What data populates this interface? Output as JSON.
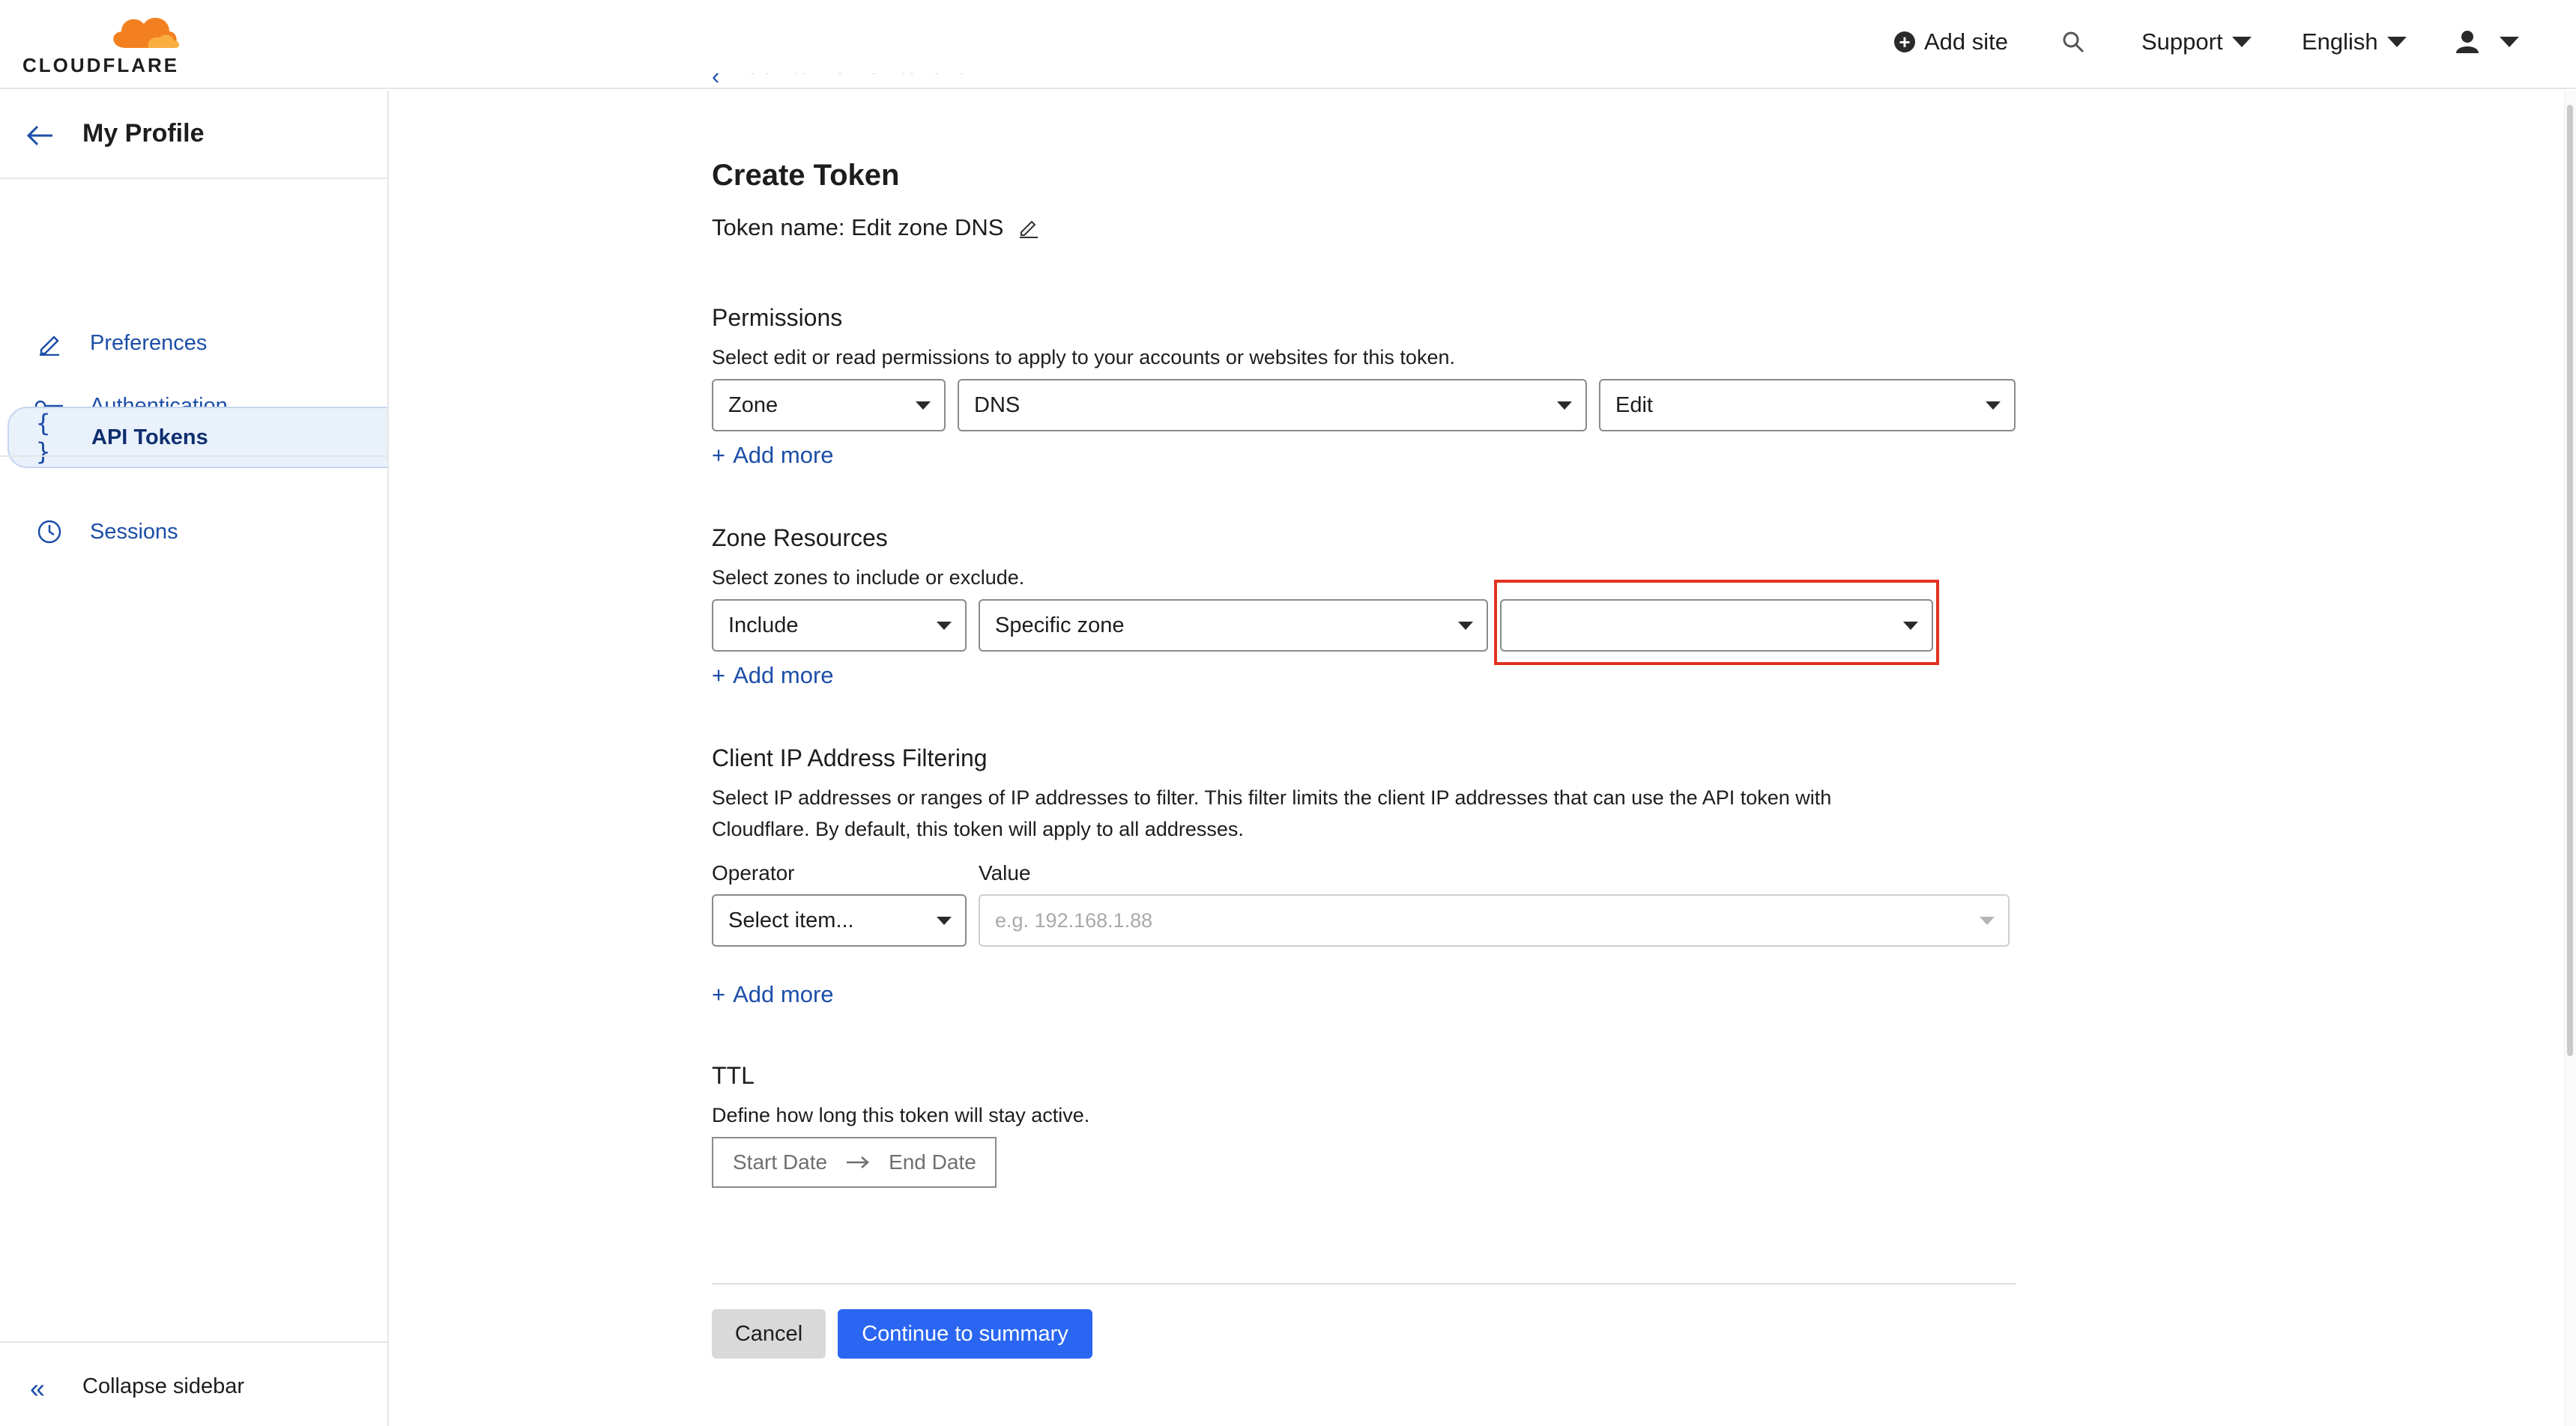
{
  "header": {
    "logo_text": "CLOUDFLARE",
    "add_site": "Add site",
    "support": "Support",
    "language": "English"
  },
  "sidebar": {
    "title": "My Profile",
    "items": [
      {
        "label": "Preferences",
        "icon": "pencil-icon"
      },
      {
        "label": "Authentication",
        "icon": "key-icon"
      },
      {
        "label": "API Tokens",
        "icon": "braces-icon",
        "active": true
      },
      {
        "label": "Sessions",
        "icon": "clock-icon"
      }
    ],
    "collapse": "Collapse sidebar"
  },
  "main": {
    "back_link": "Back to view all tokens",
    "title": "Create Token",
    "token_name": "Token name: Edit zone DNS",
    "permissions": {
      "title": "Permissions",
      "desc": "Select edit or read permissions to apply to your accounts or websites for this token.",
      "select1": "Zone",
      "select2": "DNS",
      "select3": "Edit",
      "add_more": "Add more"
    },
    "zone_resources": {
      "title": "Zone Resources",
      "desc": "Select zones to include or exclude.",
      "select1": "Include",
      "select2": "Specific zone",
      "select3": "",
      "add_more": "Add more"
    },
    "ip_filtering": {
      "title": "Client IP Address Filtering",
      "desc": "Select IP addresses or ranges of IP addresses to filter. This filter limits the client IP addresses that can use the API token with Cloudflare. By default, this token will apply to all addresses.",
      "operator_label": "Operator",
      "value_label": "Value",
      "operator_select": "Select item...",
      "value_placeholder": "e.g. 192.168.1.88",
      "add_more": "Add more"
    },
    "ttl": {
      "title": "TTL",
      "desc": "Define how long this token will stay active.",
      "start": "Start Date",
      "end": "End Date"
    },
    "buttons": {
      "cancel": "Cancel",
      "continue": "Continue to summary"
    }
  },
  "colors": {
    "accent": "#2a66f1",
    "link": "#1c4ea8",
    "highlight": "#e3321f",
    "logo_orange": "#f38020"
  }
}
